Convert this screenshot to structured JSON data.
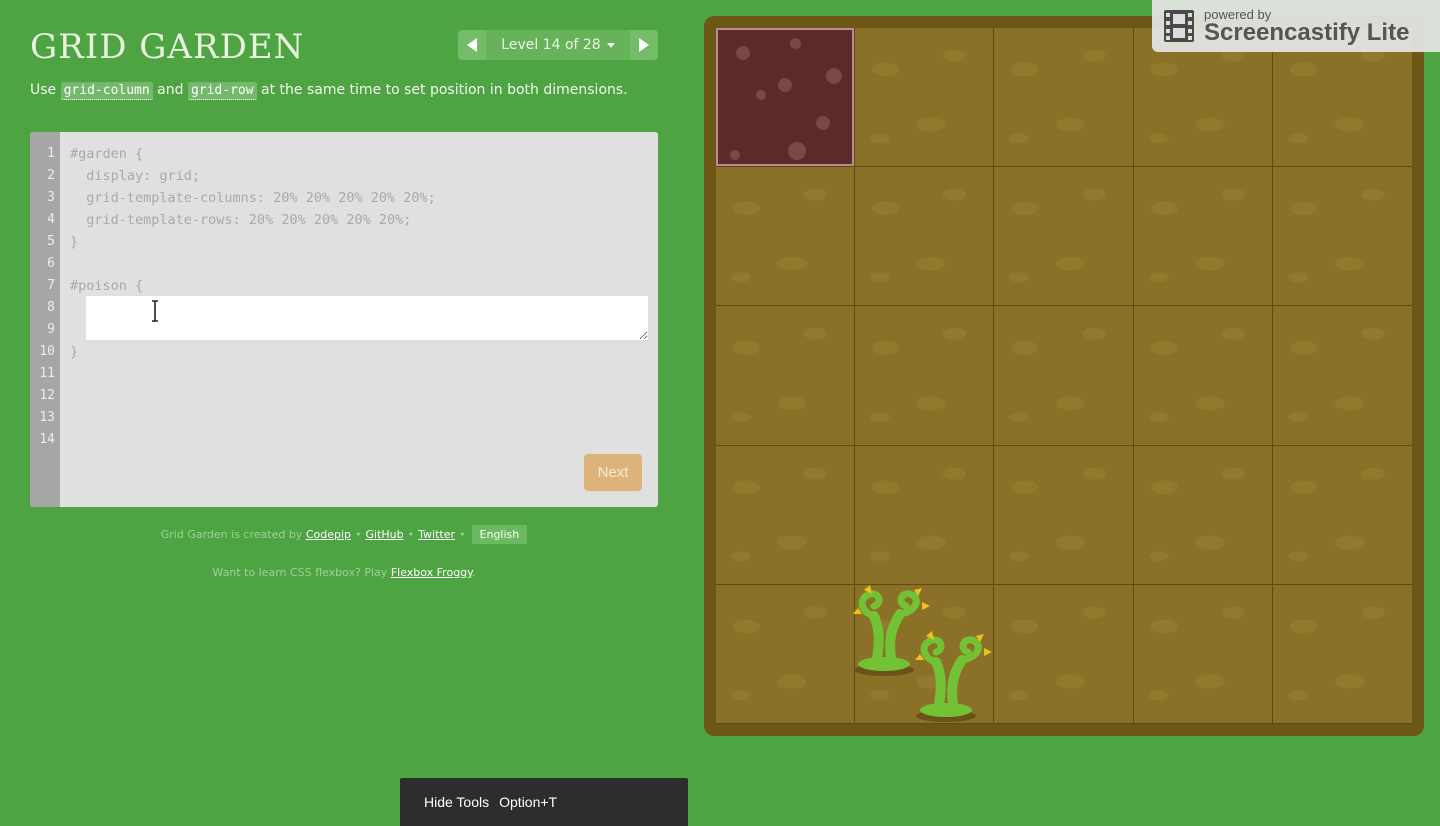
{
  "header": {
    "title": "Grid Garden",
    "level_label": "Level 14 of 28"
  },
  "instructions": {
    "before": "Use ",
    "code1": "grid-column",
    "middle": " and ",
    "code2": "grid-row",
    "after": " at the same time to set position in both dimensions."
  },
  "editor": {
    "line_numbers": [
      "1",
      "2",
      "3",
      "4",
      "5",
      "6",
      "7",
      "8",
      "9",
      "10",
      "11",
      "12",
      "13",
      "14"
    ],
    "lines": [
      "#garden {",
      "  display: grid;",
      "  grid-template-columns: 20% 20% 20% 20% 20%;",
      "  grid-template-rows: 20% 20% 20% 20% 20%;",
      "}",
      "",
      "#poison {",
      "",
      "",
      "}"
    ],
    "input_value": "",
    "next_label": "Next"
  },
  "footer": {
    "created_by": "Grid Garden is created by",
    "codepip": "Codepip",
    "github": "GitHub",
    "twitter": "Twitter",
    "language": "English",
    "learn_text": "Want to learn CSS flexbox? Play",
    "flexbox_froggy": "Flexbox Froggy",
    "period": "."
  },
  "garden": {
    "columns": 5,
    "rows": 5,
    "poison_cell": "column 1, row 1",
    "weeds": [
      "column 2, row 5",
      "column 2, row 5"
    ]
  },
  "watermark": {
    "small": "powered by",
    "big": "Screencastify Lite"
  },
  "tools_bar": {
    "label": "Hide Tools",
    "shortcut": "Option+T"
  },
  "colors": {
    "background": "#4ea443",
    "soil": "#8a7127",
    "poison": "#5b2b2b",
    "next_button": "#dcb37a"
  }
}
